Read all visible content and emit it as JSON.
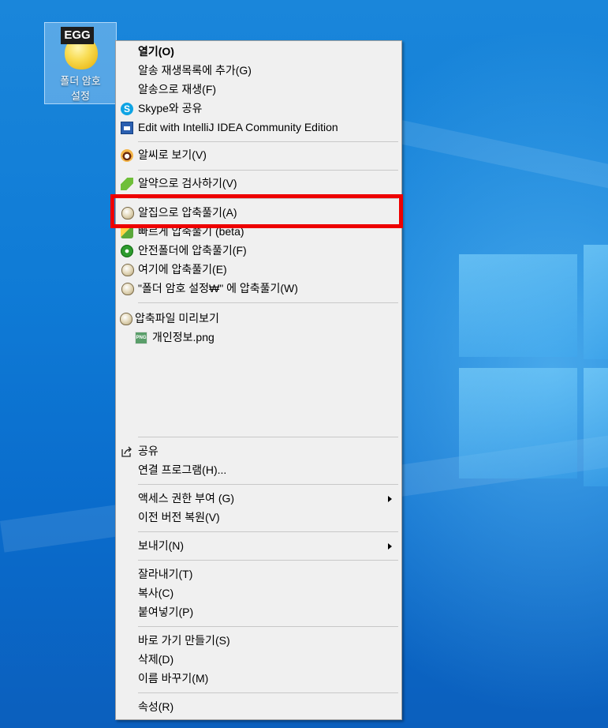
{
  "desktop_icon": {
    "badge": "EGG",
    "label": "폴더 암호\n설정"
  },
  "menu": {
    "items": [
      {
        "label": "열기(O)",
        "icon": "none"
      },
      {
        "label": "알송 재생목록에 추가(G)",
        "icon": "none"
      },
      {
        "label": "알송으로 재생(F)",
        "icon": "none"
      },
      {
        "label": "Skype와 공유",
        "icon": "skype-icon"
      },
      {
        "label": "Edit with IntelliJ IDEA Community Edition",
        "icon": "intellij-icon"
      },
      {
        "label": "알씨로 보기(V)",
        "icon": "alsee-icon"
      },
      {
        "label": "알약으로 검사하기(V)",
        "icon": "alyac-icon"
      },
      {
        "label": "알집으로 압축풀기(A)",
        "icon": "alzip-icon"
      },
      {
        "label": "빠르게 압축풀기 (beta)",
        "icon": "bandizip-icon"
      },
      {
        "label": "안전폴더에 압축풀기(F)",
        "icon": "shield-icon"
      },
      {
        "label": "여기에 압축풀기(E)",
        "icon": "alzip-icon"
      },
      {
        "label": "\"폴더 암호 설정₩\" 에 압축풀기(W)",
        "icon": "alzip-icon"
      },
      {
        "label": "압축파일 미리보기",
        "icon": "alzip-icon"
      },
      {
        "label": "개인정보.png",
        "icon": "png-file-icon"
      },
      {
        "label": "공유",
        "icon": "share-icon"
      },
      {
        "label": "연결 프로그램(H)...",
        "icon": "none"
      },
      {
        "label": "액세스 권한 부여 (G)",
        "icon": "none",
        "submenu": true
      },
      {
        "label": "이전 버전 복원(V)",
        "icon": "none"
      },
      {
        "label": "보내기(N)",
        "icon": "none",
        "submenu": true
      },
      {
        "label": "잘라내기(T)",
        "icon": "none"
      },
      {
        "label": "복사(C)",
        "icon": "none"
      },
      {
        "label": "붙여넣기(P)",
        "icon": "none"
      },
      {
        "label": "바로 가기 만들기(S)",
        "icon": "none"
      },
      {
        "label": "삭제(D)",
        "icon": "none"
      },
      {
        "label": "이름 바꾸기(M)",
        "icon": "none"
      },
      {
        "label": "속성(R)",
        "icon": "none"
      }
    ],
    "highlighted_item": "알집으로 압축풀기(A)",
    "highlight_color": "#ee0000"
  }
}
